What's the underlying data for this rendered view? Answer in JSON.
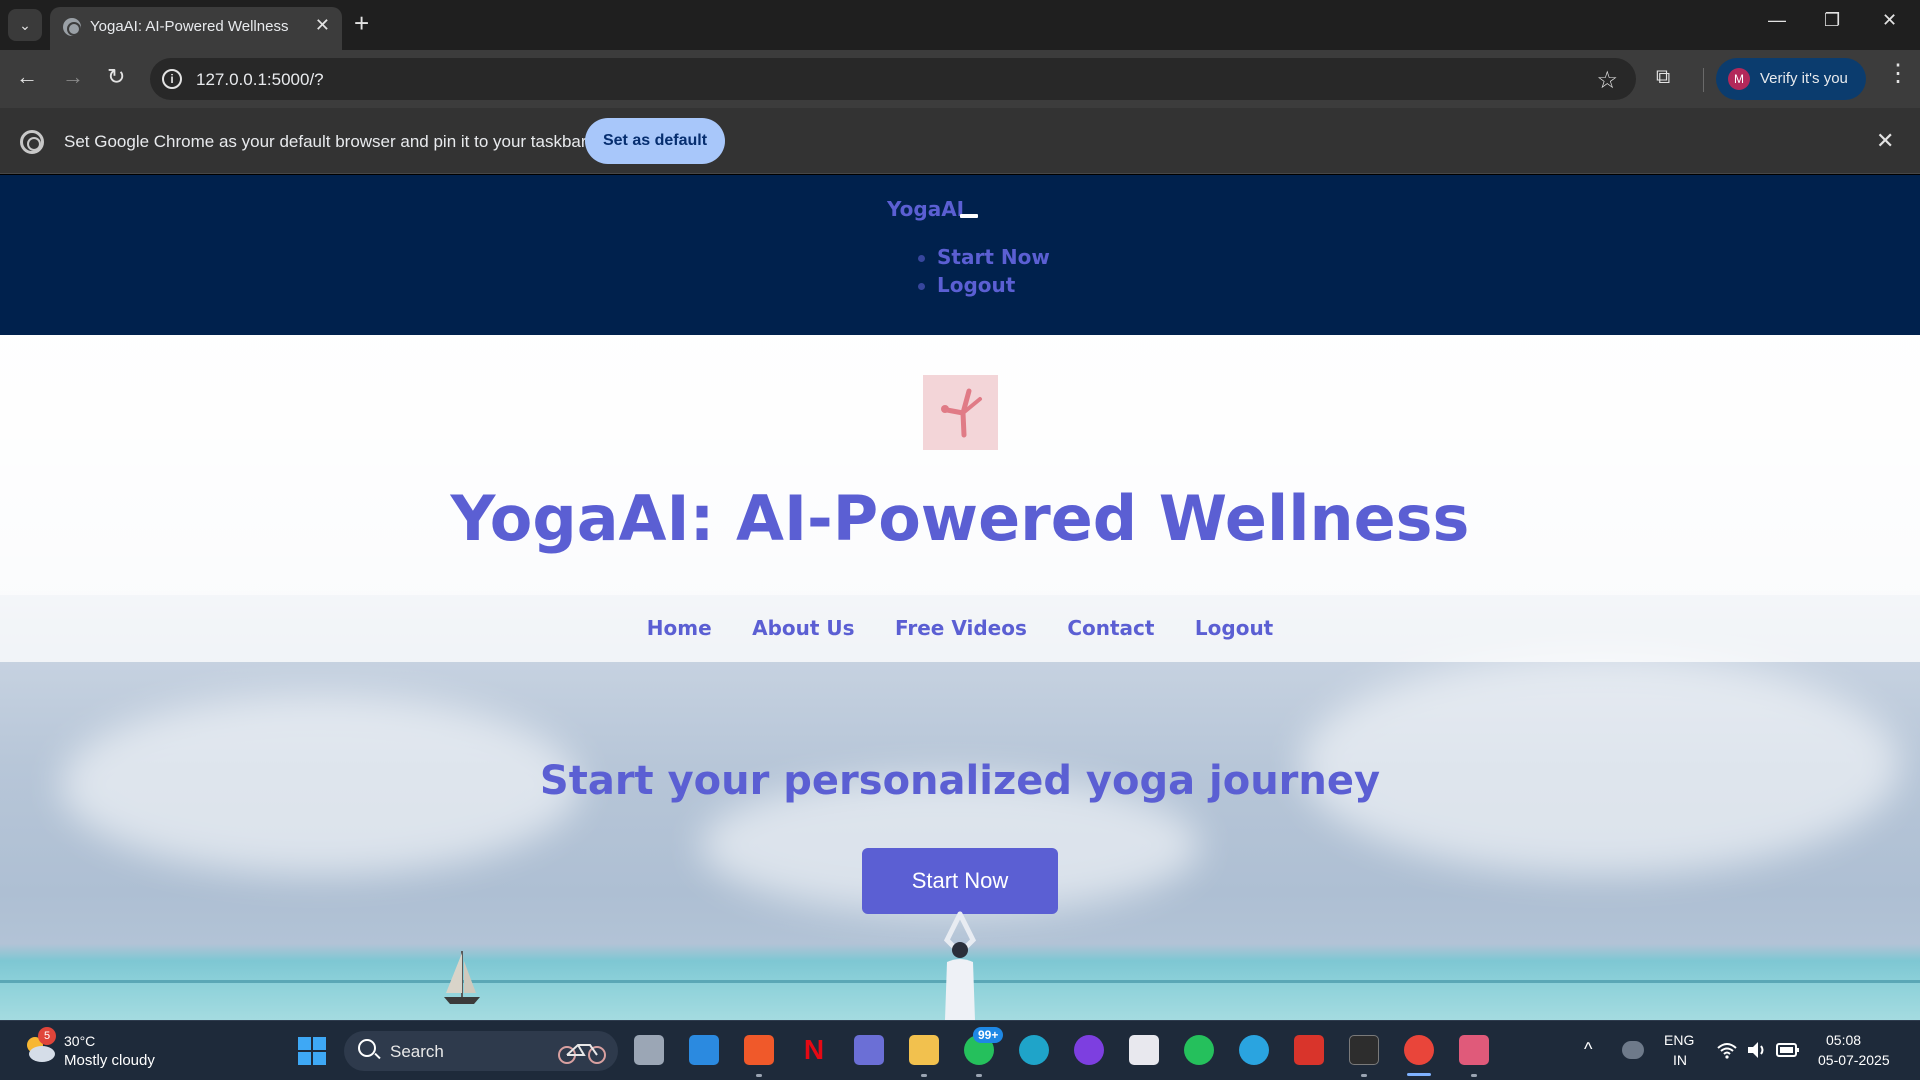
{
  "browser": {
    "tab": {
      "title": "YogaAI: AI-Powered Wellness",
      "close_glyph": "✕"
    },
    "tab_search_glyph": "⌄",
    "new_tab_glyph": "+",
    "window_controls": {
      "minimize": "—",
      "restore": "❐",
      "close": "✕"
    },
    "nav": {
      "back": "←",
      "forward": "→",
      "reload": "↻"
    },
    "address": {
      "info_glyph": "i",
      "url": "127.0.0.1:5000/?"
    },
    "bookmark_glyph": "☆",
    "extensions_glyph": "⧉",
    "profile": {
      "avatar_letter": "M",
      "label": "Verify it's you"
    },
    "menu_glyph": "⋮",
    "infobar": {
      "message": "Set Google Chrome as your default browser and pin it to your taskbar",
      "button_label": "Set as default",
      "close_glyph": "✕"
    }
  },
  "site": {
    "brand": "YogaAI",
    "top_menu": [
      "Start Now",
      "Logout"
    ],
    "title": "YogaAI: AI-Powered Wellness",
    "nav": [
      "Home",
      "About Us",
      "Free Videos",
      "Contact",
      "Logout"
    ],
    "tagline": "Start your personalized yoga journey",
    "cta_label": "Start Now",
    "colors": {
      "accent": "#5b5fd3",
      "header_bg": "#00214d",
      "logo_bg": "#f3d5d8"
    }
  },
  "taskbar": {
    "weather": {
      "badge": "5",
      "temp": "30°C",
      "desc": "Mostly cloudy"
    },
    "search_placeholder": "Search",
    "whatsapp_badge": "99+",
    "tray": {
      "chevron": "^",
      "lang_top": "ENG",
      "lang_bottom": "IN",
      "time": "05:08",
      "date": "05-07-2025"
    }
  }
}
